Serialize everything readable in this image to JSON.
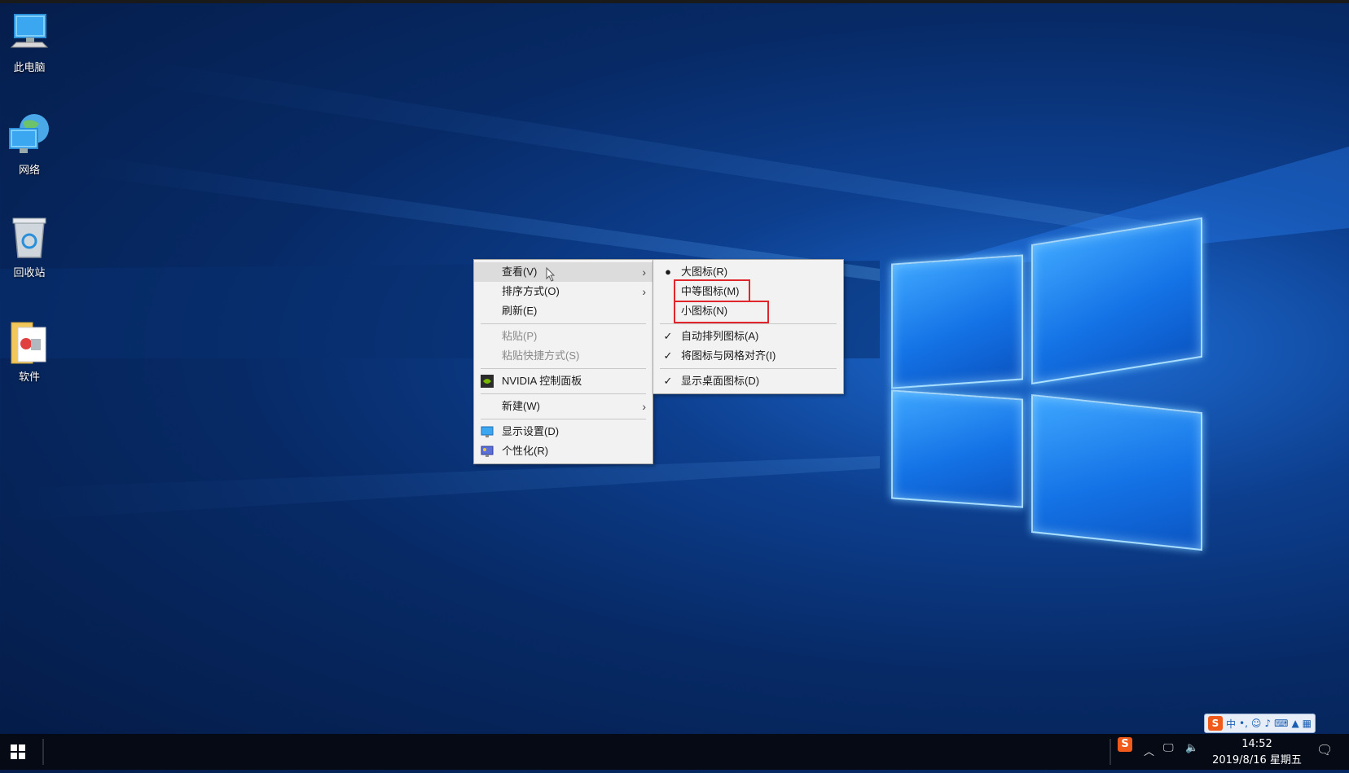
{
  "desktop_icons": [
    {
      "label": "此电脑",
      "icon": "computer-icon"
    },
    {
      "label": "网络",
      "icon": "network-icon"
    },
    {
      "label": "回收站",
      "icon": "recycle-bin-icon"
    },
    {
      "label": "软件",
      "icon": "folder-icon"
    }
  ],
  "context_menu": {
    "view": "查看(V)",
    "sort": "排序方式(O)",
    "refresh": "刷新(E)",
    "paste": "粘贴(P)",
    "paste_shortcut": "粘贴快捷方式(S)",
    "nvidia": "NVIDIA 控制面板",
    "new": "新建(W)",
    "display": "显示设置(D)",
    "personalize": "个性化(R)"
  },
  "view_submenu": {
    "large": "大图标(R)",
    "medium": "中等图标(M)",
    "small": "小图标(N)",
    "auto_arrange": "自动排列图标(A)",
    "align_grid": "将图标与网格对齐(I)",
    "show_icons": "显示桌面图标(D)",
    "selected": "large",
    "checked": [
      "auto_arrange",
      "align_grid",
      "show_icons"
    ]
  },
  "taskbar": {
    "time": "14:52",
    "date": "2019/8/16 星期五",
    "ime_label": "中"
  },
  "colors": {
    "highlight_box": "#e0262b",
    "menu_bg": "#f2f2f2"
  }
}
